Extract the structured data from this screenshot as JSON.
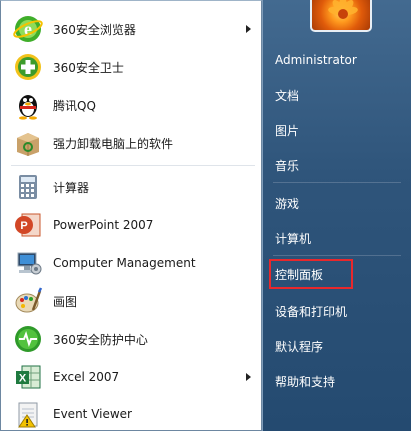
{
  "programs": [
    {
      "label": "360安全浏览器",
      "icon": "ie-browser-icon",
      "has_submenu": true
    },
    {
      "label": "360安全卫士",
      "icon": "shield-plus-icon",
      "has_submenu": false
    },
    {
      "label": "腾讯QQ",
      "icon": "penguin-icon",
      "has_submenu": false
    },
    {
      "label": "强力卸载电脑上的软件",
      "icon": "recycle-box-icon",
      "has_submenu": false
    },
    {
      "label": "计算器",
      "icon": "calculator-icon",
      "has_submenu": false
    },
    {
      "label": "PowerPoint 2007",
      "icon": "powerpoint-icon",
      "has_submenu": false
    },
    {
      "label": "Computer Management",
      "icon": "computer-management-icon",
      "has_submenu": false
    },
    {
      "label": "画图",
      "icon": "paint-palette-icon",
      "has_submenu": false
    },
    {
      "label": "360安全防护中心",
      "icon": "heartbeat-shield-icon",
      "has_submenu": false
    },
    {
      "label": "Excel 2007",
      "icon": "excel-icon",
      "has_submenu": true
    },
    {
      "label": "Event Viewer",
      "icon": "event-viewer-icon",
      "has_submenu": false
    }
  ],
  "right_items": [
    {
      "label": "Administrator",
      "highlight": false
    },
    {
      "label": "文档",
      "highlight": false
    },
    {
      "label": "图片",
      "highlight": false
    },
    {
      "label": "音乐",
      "highlight": false
    },
    {
      "label": "游戏",
      "highlight": false
    },
    {
      "label": "计算机",
      "highlight": false
    },
    {
      "label": "控制面板",
      "highlight": true
    },
    {
      "label": "设备和打印机",
      "highlight": false
    },
    {
      "label": "默认程序",
      "highlight": false
    },
    {
      "label": "帮助和支持",
      "highlight": false
    }
  ],
  "colors": {
    "highlight_box": "#e8282c",
    "right_pane": "#2f557b"
  }
}
